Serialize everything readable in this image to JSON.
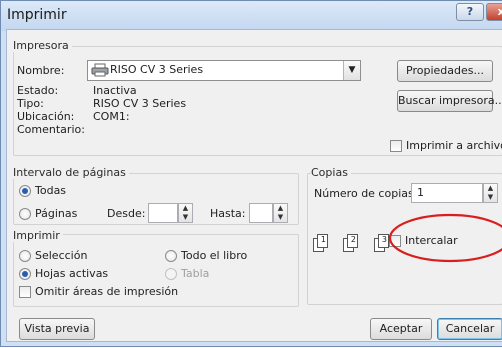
{
  "window": {
    "title": "Imprimir",
    "help_label": "?",
    "close_label": "x"
  },
  "printer": {
    "group_label": "Impresora",
    "name_label": "Nombre:",
    "name_value": "RISO CV 3 Series",
    "status_label": "Estado:",
    "status_value": "Inactiva",
    "type_label": "Tipo:",
    "type_value": "RISO CV 3 Series",
    "location_label": "Ubicación:",
    "location_value": "COM1:",
    "comment_label": "Comentario:",
    "properties_button": "Propiedades...",
    "find_button": "Buscar impresora...",
    "print_to_file_label": "Imprimir a archivo"
  },
  "page_range": {
    "group_label": "Intervalo de páginas",
    "all_label": "Todas",
    "pages_label": "Páginas",
    "from_label": "Desde:",
    "to_label": "Hasta:"
  },
  "copies": {
    "group_label": "Copias",
    "count_label": "Número de copias:",
    "count_value": "1",
    "collate_label": "Intercalar",
    "page_labels": [
      "1",
      "2",
      "3"
    ]
  },
  "print_what": {
    "group_label": "Imprimir",
    "selection_label": "Selección",
    "entire_book_label": "Todo el libro",
    "active_sheets_label": "Hojas activas",
    "table_label": "Tabla",
    "ignore_print_areas_label": "Omitir áreas de impresión"
  },
  "footer": {
    "preview_button": "Vista previa",
    "ok_button": "Aceptar",
    "cancel_button": "Cancelar"
  },
  "colors": {
    "annotation_circle": "#d81e1e",
    "radio_selected": "#2a5db0"
  }
}
